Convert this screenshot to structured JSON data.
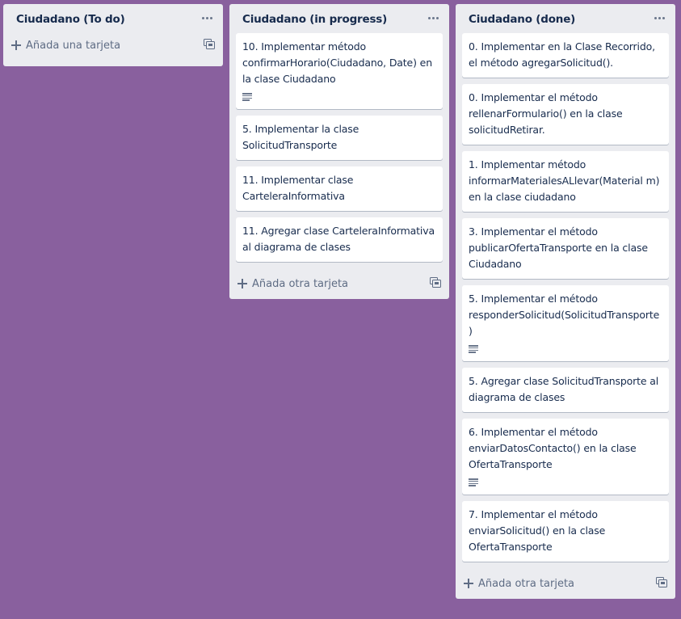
{
  "lists": [
    {
      "title": "Ciudadano (To do)",
      "cards": [],
      "add_label": "Añada una tarjeta"
    },
    {
      "title": "Ciudadano (in progress)",
      "cards": [
        {
          "text": "10. Implementar método confirmarHorario(Ciudadano, Date) en la clase Ciudadano",
          "has_description": true
        },
        {
          "text": "5. Implementar la clase SolicitudTransporte",
          "has_description": false
        },
        {
          "text": "11. Implementar clase CarteleraInformativa",
          "has_description": false
        },
        {
          "text": "11. Agregar clase CarteleraInformativa al diagrama de clases",
          "has_description": false
        }
      ],
      "add_label": "Añada otra tarjeta"
    },
    {
      "title": "Ciudadano (done)",
      "cards": [
        {
          "text": "0. Implementar en la Clase Recorrido, el método agregarSolicitud().",
          "has_description": false
        },
        {
          "text": "0. Implementar el método rellenarFormulario() en la clase solicitudRetirar.",
          "has_description": false
        },
        {
          "text": "1. Implementar método informarMaterialesALlevar(Material m) en la clase ciudadano",
          "has_description": false
        },
        {
          "text": "3. Implementar el método publicarOfertaTransporte en la clase Ciudadano",
          "has_description": false
        },
        {
          "text": "5. Implementar el método responderSolicitud(SolicitudTransporte)",
          "has_description": true
        },
        {
          "text": "5. Agregar clase SolicitudTransporte al diagrama de clases",
          "has_description": false
        },
        {
          "text": "6. Implementar el método enviarDatosContacto() en la clase OfertaTransporte",
          "has_description": true
        },
        {
          "text": "7. Implementar el método enviarSolicitud() en la clase OfertaTransporte",
          "has_description": false
        }
      ],
      "add_label": "Añada otra tarjeta"
    }
  ],
  "icons": {
    "list_menu": "more-horizontal-icon",
    "add": "plus-icon",
    "template": "card-template-icon",
    "description": "description-icon"
  },
  "colors": {
    "board_background": "#89609e",
    "list_background": "#ebecf0",
    "card_background": "#ffffff",
    "text": "#172b4d",
    "muted_text": "#5e6c84"
  }
}
